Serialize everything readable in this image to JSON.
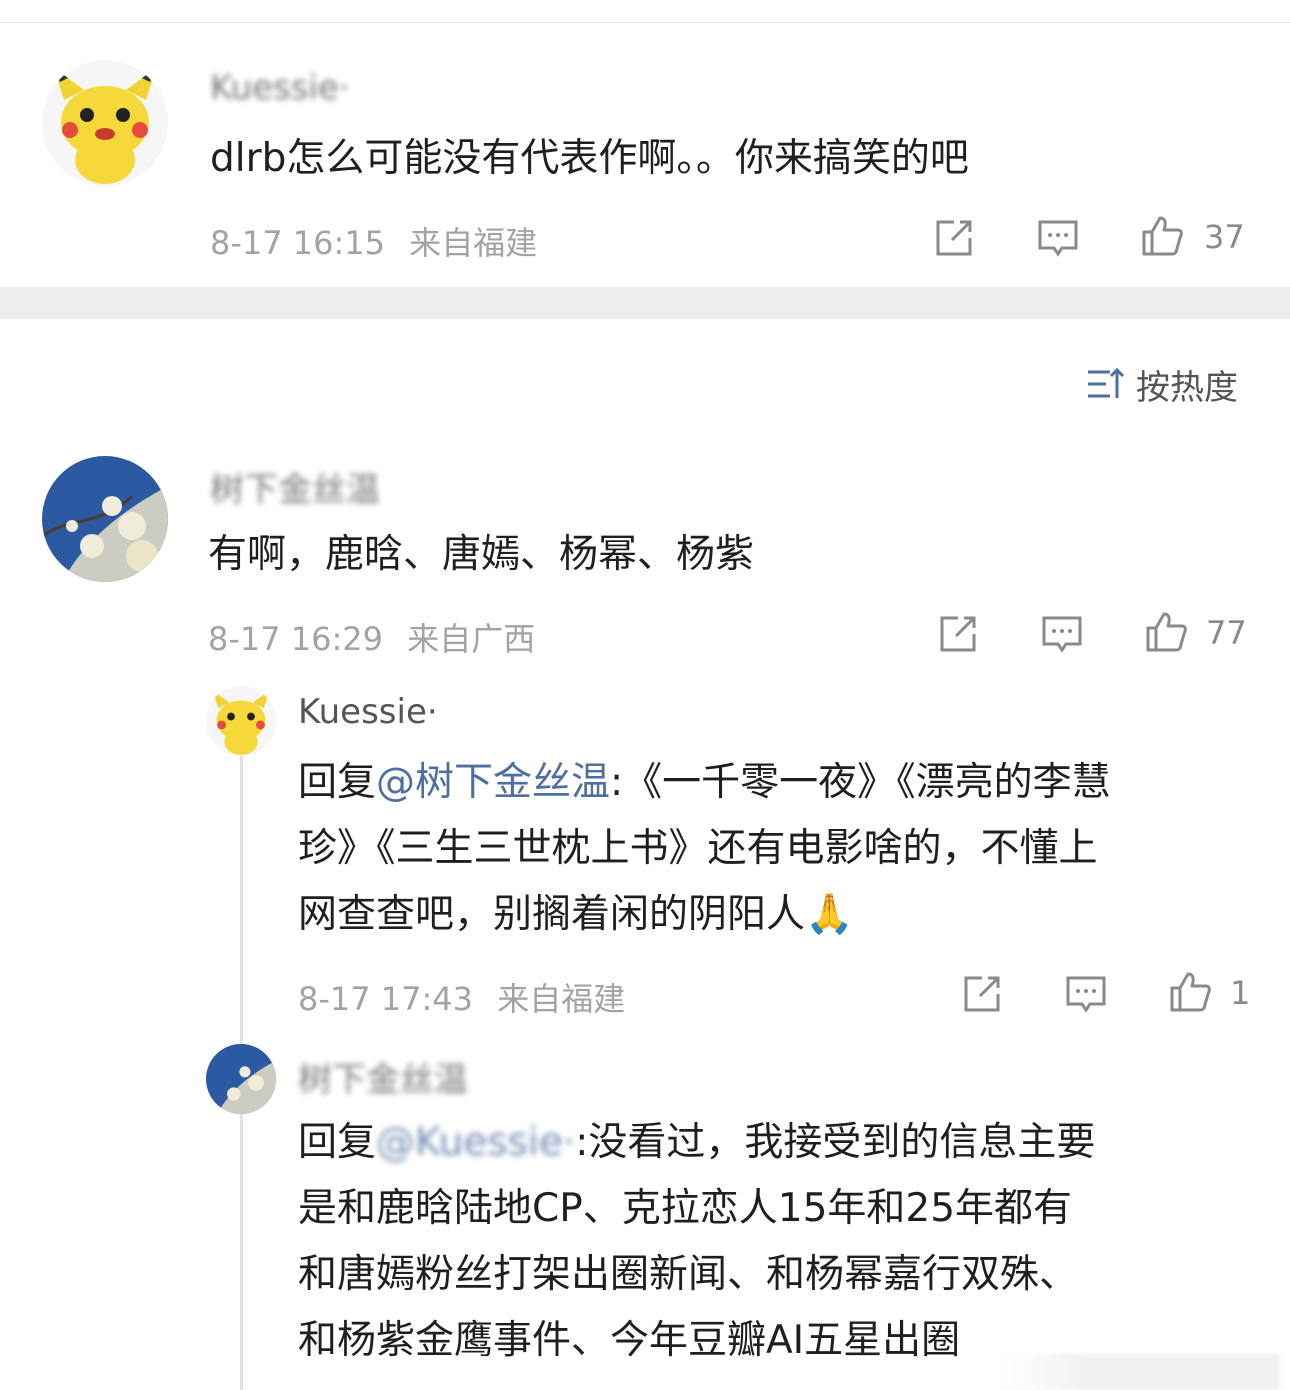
{
  "comments": [
    {
      "author": "Kuessie·",
      "text": "dlrb怎么可能没有代表作啊。。你来搞笑的吧",
      "time": "8-17 16:15",
      "location": "来自福建",
      "likes": "37"
    },
    {
      "author": "树下金丝温",
      "text": "有啊，鹿晗、唐嫣、杨幂、杨紫",
      "time": "8-17 16:29",
      "location": "来自广西",
      "likes": "77"
    }
  ],
  "sort": {
    "label": "按热度",
    "icon": "sort-icon"
  },
  "replies": [
    {
      "author": "Kuessie·",
      "reply_prefix": "回复",
      "mention": "@树下金丝温",
      "lines": [
        "《一千零一夜》《漂亮的李慧",
        "珍》《三生三世枕上书》还有电影啥的，不懂上",
        "网查查吧，别搁着闲的阴阳人🙏"
      ],
      "line1_sep": ":",
      "time": "8-17 17:43",
      "location": "来自福建",
      "likes": "1"
    },
    {
      "author": "树下金丝温",
      "reply_prefix": "回复",
      "mention": "@Kuessie·",
      "lines": [
        "没看过，我接受到的信息主要",
        "是和鹿晗陆地CP、克拉恋人15年和25年都有",
        "和唐嫣粉丝打架出圈新闻、和杨幂嘉行双殊、",
        "和杨紫金鹰事件、今年豆瓣AI五星出圈"
      ],
      "line1_sep": ":",
      "time": "",
      "location": "",
      "likes": ""
    }
  ],
  "icons": {
    "share": "share-icon",
    "comment": "comment-icon",
    "like": "like-icon"
  },
  "colors": {
    "mention": "#4f6ea1",
    "meta": "#a3a3a3",
    "divider": "#ededed"
  }
}
